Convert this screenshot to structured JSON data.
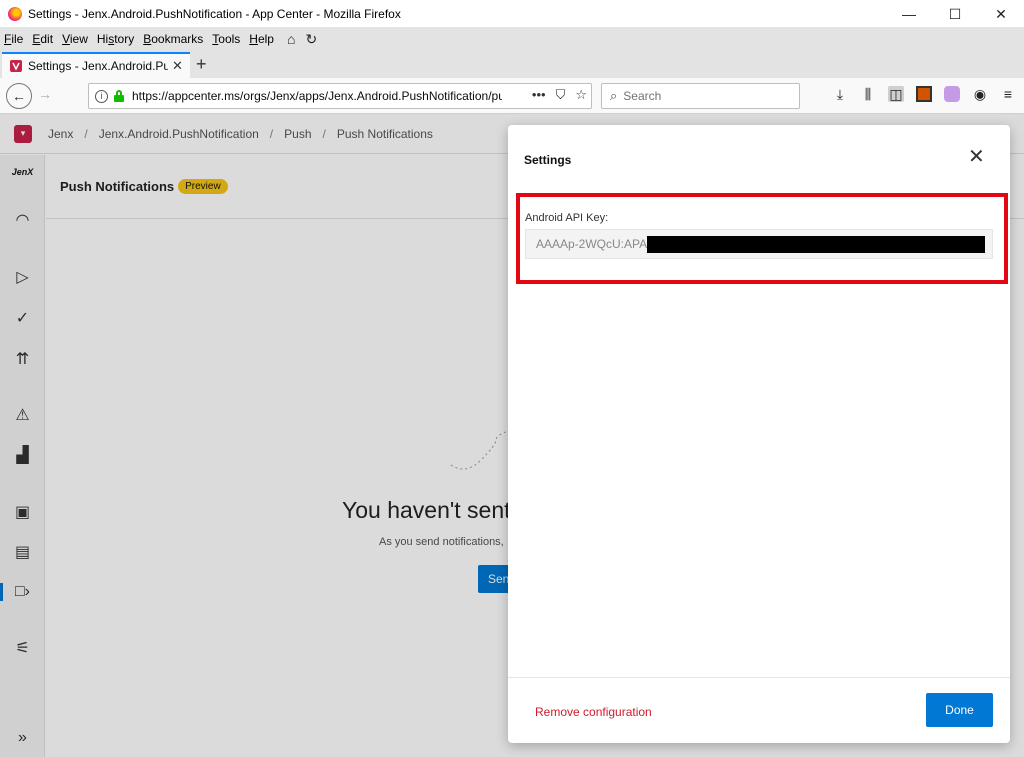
{
  "window": {
    "title": "Settings - Jenx.Android.PushNotification - App Center - Mozilla Firefox",
    "controls": {
      "minimize": "—",
      "maximize": "☐",
      "close": "✕"
    }
  },
  "menubar": {
    "items": [
      {
        "label": "File",
        "accel": "F",
        "rest": "ile"
      },
      {
        "label": "Edit",
        "accel": "E",
        "rest": "dit"
      },
      {
        "label": "View",
        "accel": "V",
        "rest": "iew"
      },
      {
        "label": "History",
        "pre": "Hi",
        "accel": "s",
        "rest": "tory"
      },
      {
        "label": "Bookmarks",
        "accel": "B",
        "rest": "ookmarks"
      },
      {
        "label": "Tools",
        "accel": "T",
        "rest": "ools"
      },
      {
        "label": "Help",
        "accel": "H",
        "rest": "elp"
      }
    ],
    "icons": [
      "home-icon",
      "reload-icon"
    ]
  },
  "tabs": [
    {
      "title": "Settings - Jenx.Android.PushNotification - App Center",
      "active": true
    }
  ],
  "navbar": {
    "url": "https://appcenter.ms/orgs/Jenx/apps/Jenx.Android.PushNotification/push",
    "search_placeholder": "Search",
    "url_actions": [
      "•••",
      "⛉",
      "☆"
    ]
  },
  "app_header": {
    "breadcrumbs": [
      "Jenx",
      "Jenx.Android.PushNotification",
      "Push",
      "Push Notifications"
    ],
    "separator": "/"
  },
  "rail": {
    "org_label": "JenX",
    "items": [
      "overview-icon",
      "build-icon",
      "test-icon",
      "distribute-icon",
      "diagnostics-icon",
      "analytics-icon",
      "auth-icon",
      "data-icon",
      "push-icon",
      "settings-icon",
      "expand-icon"
    ]
  },
  "main": {
    "title": "Push Notifications",
    "badge": "Preview",
    "empty_title": "You haven't sent",
    "empty_sub": "As you send notifications,",
    "send_button": "Sen"
  },
  "settings_panel": {
    "title": "Settings",
    "close_icon": "✕",
    "field_label": "Android API Key:",
    "field_value_visible": "AAAAp-2WQcU:APA",
    "field_value_redacted": true,
    "remove_label": "Remove configuration",
    "done_label": "Done",
    "highlight_color": "#e30613"
  },
  "colors": {
    "accent": "#0078d4",
    "danger": "#d01b2a",
    "badge": "#f5c518",
    "brand": "#c6224b"
  }
}
